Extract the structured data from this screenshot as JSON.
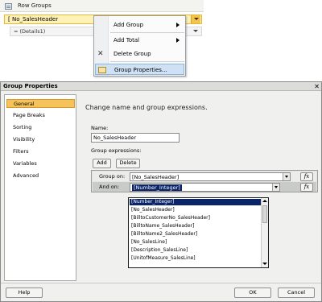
{
  "row_groups": {
    "title": "Row Groups",
    "group_row_label": "[ No_SalesHeader",
    "details_label": "= (Details1)"
  },
  "context_menu": {
    "items": [
      {
        "label": "Add Group",
        "has_submenu": true
      },
      {
        "label": "Add Total",
        "has_submenu": true
      },
      {
        "label": "Delete Group",
        "icon": "delete-x-icon"
      },
      {
        "label": "Group Properties...",
        "icon": "properties-icon",
        "highlighted": true
      }
    ]
  },
  "dialog": {
    "title": "Group Properties",
    "close": "✕",
    "nav": [
      "General",
      "Page Breaks",
      "Sorting",
      "Visibility",
      "Filters",
      "Variables",
      "Advanced"
    ],
    "selected_nav": "General",
    "heading": "Change name and group expressions.",
    "name_label": "Name:",
    "name_value": "No_SalesHeader",
    "group_expressions_label": "Group expressions:",
    "add_label": "Add",
    "delete_label": "Delete",
    "group_on_label": "Group on:",
    "group_on_value": "[No_SalesHeader]",
    "and_on_label": "And on:",
    "and_on_value": "[Number_Integer]",
    "fx_label": "fx",
    "dropdown_options": [
      "[Number_Integer]",
      "[No_SalesHeader]",
      "[BilltoCustomerNo_SalesHeader]",
      "[BilltoName_SalesHeader]",
      "[BilltoName2_SalesHeader]",
      "[No_SalesLine]",
      "[Description_SalesLine]",
      "[UnitofMeasure_SalesLine]"
    ],
    "help_label": "Help",
    "ok_label": "OK",
    "cancel_label": "Cancel"
  },
  "colors": {
    "highlight": "#0a246a",
    "selected_nav": "#f6c35a",
    "group_row": "#fff2b8"
  }
}
